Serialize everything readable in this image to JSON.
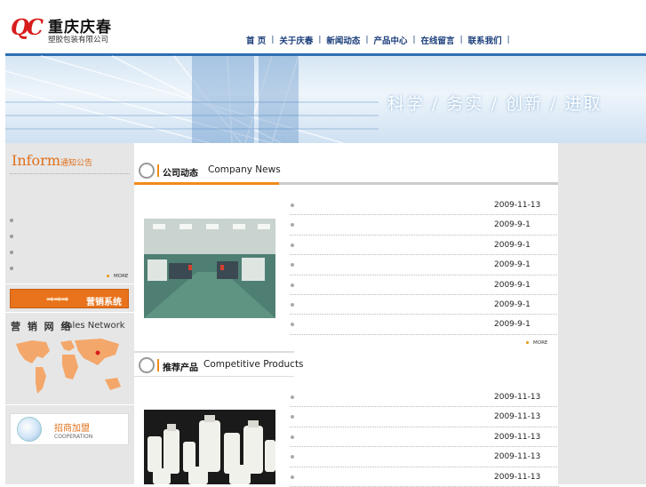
{
  "header": {
    "logo_mark": "QC",
    "company_name": "重庆庆春",
    "company_sub": "塑胶包装有限公司",
    "nav": [
      "首 页",
      "关于庆春",
      "新闻动态",
      "产品中心",
      "在线留言",
      "联系我们"
    ]
  },
  "banner": {
    "slogan": "科学 / 务实 / 创新 / 进取"
  },
  "left": {
    "inform_title": "Inform",
    "inform_cn": "通知公告",
    "more": "MORE",
    "sales_button": "营销系统",
    "network_cn": "营 销 网 络",
    "network_en": "Sales Network",
    "coop_cn": "招商加盟",
    "coop_en": "COOPERATION"
  },
  "news": {
    "title_cn": "公司动态",
    "title_en": "Company News",
    "dates": [
      "2009-11-13",
      "2009-9-1",
      "2009-9-1",
      "2009-9-1",
      "2009-9-1",
      "2009-9-1",
      "2009-9-1"
    ],
    "more": "MORE"
  },
  "products": {
    "title_cn": "推荐产品",
    "title_en": "Competitive Products",
    "dates": [
      "2009-11-13",
      "2009-11-13",
      "2009-11-13",
      "2009-11-13",
      "2009-11-13"
    ]
  },
  "colors": {
    "accent": "#f08a1c",
    "nav_blue": "#1a3d7a",
    "logo_red": "#d81c1c"
  }
}
